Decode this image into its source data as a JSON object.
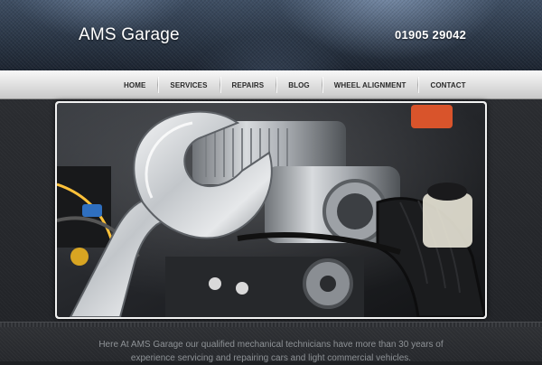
{
  "header": {
    "brand": "AMS Garage",
    "phone": "01905 29042"
  },
  "nav": {
    "items": [
      {
        "label": "HOME"
      },
      {
        "label": "SERVICES"
      },
      {
        "label": "REPAIRS"
      },
      {
        "label": "BLOG"
      },
      {
        "label": "WHEEL ALIGNMENT"
      },
      {
        "label": "CONTACT"
      }
    ]
  },
  "hero": {
    "image_subject": "wrench-over-engine-bay"
  },
  "intro": {
    "text": "Here At AMS Garage our qualified mechanical technicians have more than 30 years of experience servicing and repairing cars and light commercial vehicles."
  },
  "colors": {
    "header_bg": "#2a3646",
    "nav_bg": "#e2e2e2",
    "body_bg": "#222428",
    "intro_text": "#8e9296"
  }
}
